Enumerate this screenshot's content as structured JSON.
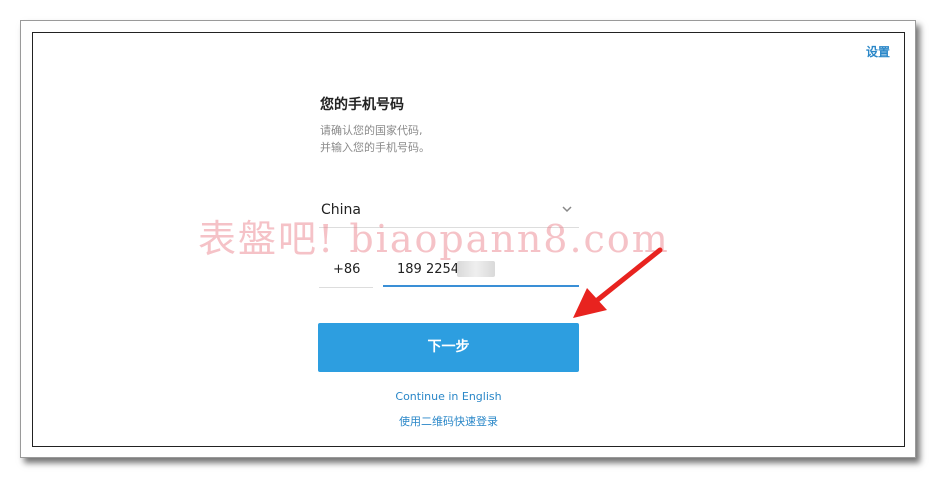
{
  "header": {
    "settings_label": "设置"
  },
  "form": {
    "title": "您的手机号码",
    "description_line1": "请确认您的国家代码,",
    "description_line2": "并输入您的手机号码。",
    "country": "China",
    "country_code": "+86",
    "phone_number": "189 2254"
  },
  "actions": {
    "next_label": "下一步",
    "continue_english_label": "Continue in English",
    "qr_login_label": "使用二维码快速登录"
  },
  "overlay": {
    "watermark_text": "表盤吧! biaopann8.com"
  },
  "colors": {
    "accent": "#2d9ee0",
    "link": "#2a87c8",
    "arrow": "#e8231f"
  },
  "icons": {
    "country_chevron": "chevron-down-icon",
    "annotation_arrow": "red-arrow-icon"
  }
}
